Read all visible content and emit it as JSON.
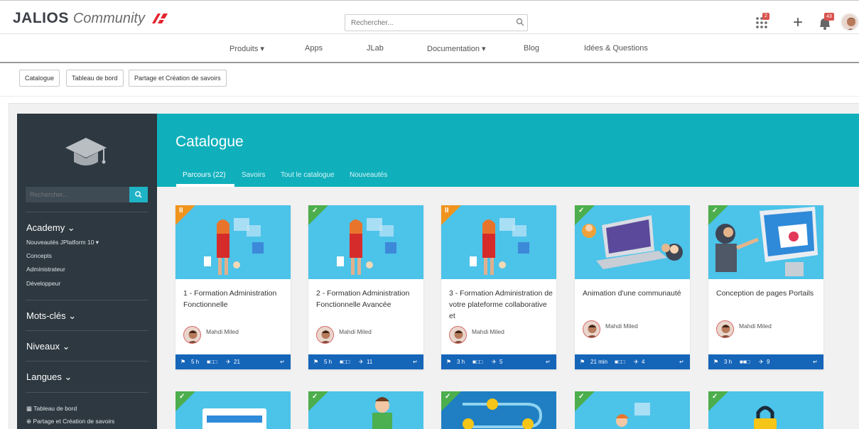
{
  "header": {
    "logo_main": "JALIOS",
    "logo_sub": "Community",
    "search_placeholder": "Rechercher...",
    "apps_badge": "2",
    "notif_badge": "43"
  },
  "nav": {
    "items": [
      "Produits ▾",
      "Apps",
      "JLab",
      "Documentation ▾",
      "Blog",
      "Idées & Questions"
    ]
  },
  "crumbs": [
    "Catalogue",
    "Tableau de bord",
    "Partage et Création de savoirs"
  ],
  "sidebar": {
    "search_placeholder": "Rechercher...",
    "academy": "Academy ⌄",
    "academy_items": [
      "Nouveautés JPlatform 10 ▾",
      "Concepts",
      "Administrateur",
      "Développeur"
    ],
    "keywords": "Mots-clés ⌄",
    "levels": "Niveaux ⌄",
    "languages": "Langues ⌄",
    "dashboard": "Tableau de bord",
    "share": "Partage et Création de savoirs"
  },
  "catalogue": {
    "title": "Catalogue",
    "tabs": [
      "Parcours (22)",
      "Savoirs",
      "Tout le catalogue",
      "Nouveautés"
    ]
  },
  "cards": [
    {
      "title": "1 - Formation Administration Fonctionnelle",
      "author": "Mahdi Miled",
      "duration": "5 h",
      "count": "21",
      "status": "paused"
    },
    {
      "title": "2 - Formation Administration Fonctionnelle Avancée",
      "author": "Mahdi Miled",
      "duration": "5 h",
      "count": "11",
      "status": "done"
    },
    {
      "title": "3 - Formation Administration de votre plateforme collaborative et",
      "author": "Mahdi Miled",
      "duration": "3 h",
      "count": "5",
      "status": "paused"
    },
    {
      "title": "Animation d'une communauté",
      "author": "Mahdi Miled",
      "duration": "21 min",
      "count": "4",
      "status": "done"
    },
    {
      "title": "Conception de pages Portails",
      "author": "Mahdi Miled",
      "duration": "3 h",
      "count": "9",
      "status": "done"
    }
  ],
  "colors": {
    "teal": "#0fb0bc",
    "sidebar": "#2d3840",
    "card_footer": "#1565b9",
    "done": "#4cae4c",
    "paused": "#f0941e"
  }
}
